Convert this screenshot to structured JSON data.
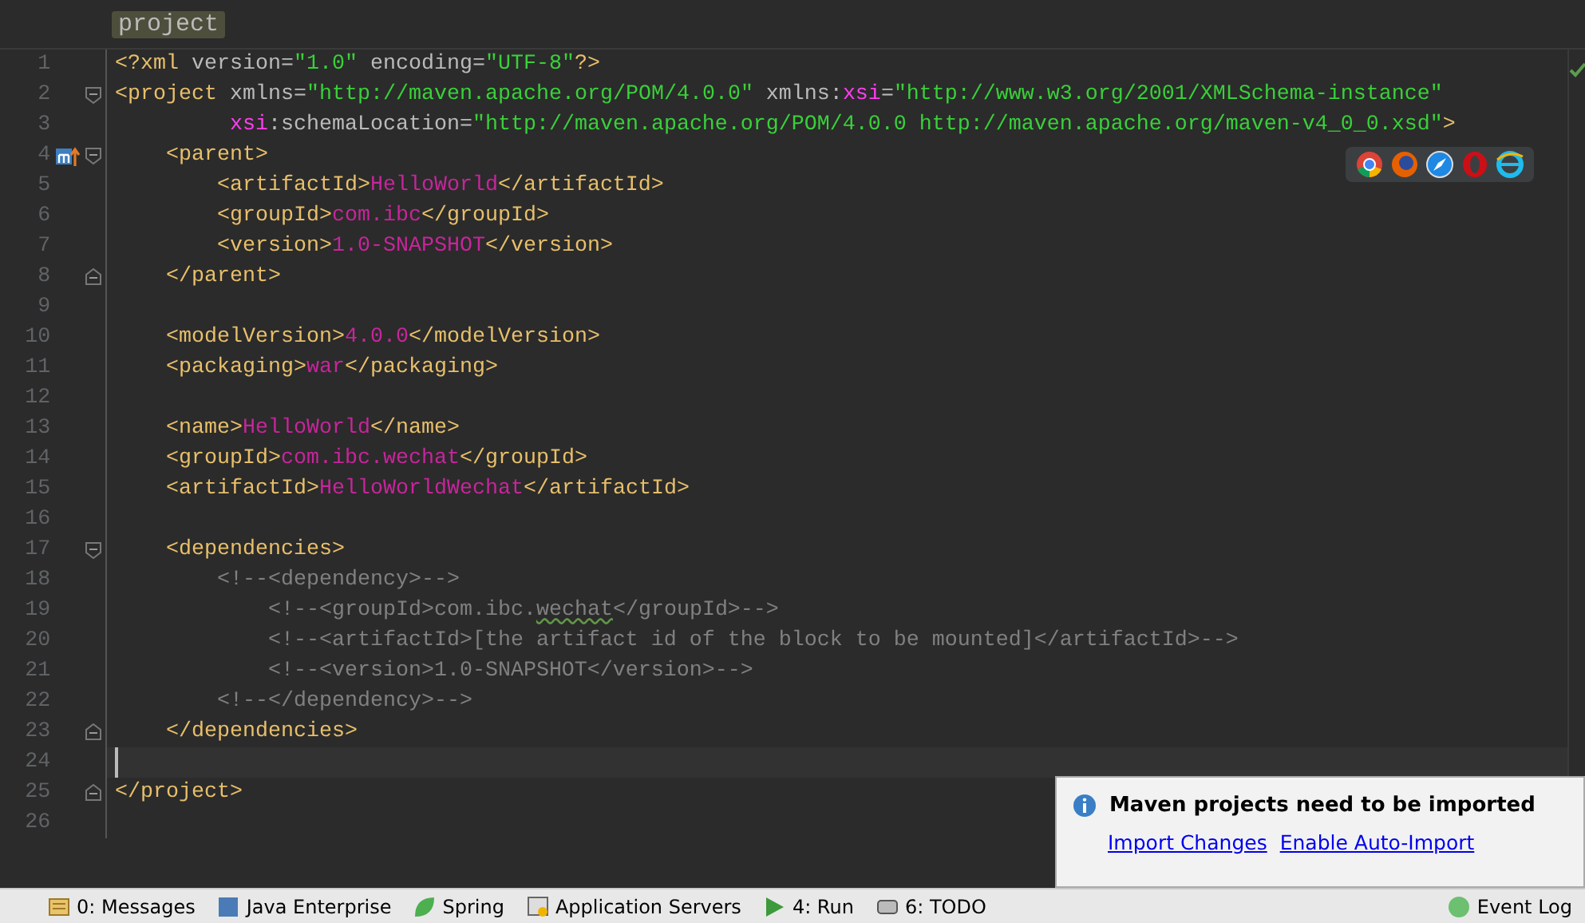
{
  "breadcrumb": {
    "label": "project"
  },
  "lines": [
    {
      "number": "1",
      "fold_start": false,
      "fold_end": false,
      "override": false,
      "current": false,
      "tokens": [
        {
          "kind": "tag",
          "text": "<?xml"
        },
        {
          "kind": "attr",
          "text": " version="
        },
        {
          "kind": "value",
          "text": "\"1.0\""
        },
        {
          "kind": "attr",
          "text": " encoding="
        },
        {
          "kind": "value",
          "text": "\"UTF-8\""
        },
        {
          "kind": "tag",
          "text": "?>"
        }
      ]
    },
    {
      "number": "2",
      "fold_start": true,
      "fold_end": false,
      "override": false,
      "current": false,
      "tokens": [
        {
          "kind": "tag",
          "text": "<project"
        },
        {
          "kind": "attr",
          "text": " xmlns="
        },
        {
          "kind": "value",
          "text": "\"http://maven.apache.org/POM/4.0.0\""
        },
        {
          "kind": "attr",
          "text": " xmlns:"
        },
        {
          "kind": "ns",
          "text": "xsi"
        },
        {
          "kind": "attr",
          "text": "="
        },
        {
          "kind": "value",
          "text": "\"http://www.w3.org/2001/XMLSchema-instance\""
        }
      ]
    },
    {
      "number": "3",
      "fold_start": false,
      "fold_end": false,
      "override": false,
      "current": false,
      "tokens": [
        {
          "kind": "ns",
          "text": "         xsi"
        },
        {
          "kind": "attr",
          "text": ":schemaLocation="
        },
        {
          "kind": "value",
          "text": "\"http://maven.apache.org/POM/4.0.0 http://maven.apache.org/maven-v4_0_0.xsd\""
        },
        {
          "kind": "tag",
          "text": ">"
        }
      ]
    },
    {
      "number": "4",
      "fold_start": true,
      "fold_end": false,
      "override": true,
      "current": false,
      "tokens": [
        {
          "kind": "tag",
          "text": "    <parent>"
        }
      ]
    },
    {
      "number": "5",
      "fold_start": false,
      "fold_end": false,
      "override": false,
      "current": false,
      "tokens": [
        {
          "kind": "tag",
          "text": "        <artifactId>"
        },
        {
          "kind": "content",
          "text": "HelloWorld"
        },
        {
          "kind": "tag",
          "text": "</artifactId>"
        }
      ]
    },
    {
      "number": "6",
      "fold_start": false,
      "fold_end": false,
      "override": false,
      "current": false,
      "tokens": [
        {
          "kind": "tag",
          "text": "        <groupId>"
        },
        {
          "kind": "content",
          "text": "com.ibc"
        },
        {
          "kind": "tag",
          "text": "</groupId>"
        }
      ]
    },
    {
      "number": "7",
      "fold_start": false,
      "fold_end": false,
      "override": false,
      "current": false,
      "tokens": [
        {
          "kind": "tag",
          "text": "        <version>"
        },
        {
          "kind": "content",
          "text": "1.0-SNAPSHOT"
        },
        {
          "kind": "tag",
          "text": "</version>"
        }
      ]
    },
    {
      "number": "8",
      "fold_start": false,
      "fold_end": true,
      "override": false,
      "current": false,
      "tokens": [
        {
          "kind": "tag",
          "text": "    </parent>"
        }
      ]
    },
    {
      "number": "9",
      "fold_start": false,
      "fold_end": false,
      "override": false,
      "current": false
    },
    {
      "number": "10",
      "fold_start": false,
      "fold_end": false,
      "override": false,
      "current": false,
      "tokens": [
        {
          "kind": "tag",
          "text": "    <modelVersion>"
        },
        {
          "kind": "content",
          "text": "4.0.0"
        },
        {
          "kind": "tag",
          "text": "</modelVersion>"
        }
      ]
    },
    {
      "number": "11",
      "fold_start": false,
      "fold_end": false,
      "override": false,
      "current": false,
      "tokens": [
        {
          "kind": "tag",
          "text": "    <packaging>"
        },
        {
          "kind": "content",
          "text": "war"
        },
        {
          "kind": "tag",
          "text": "</packaging>"
        }
      ]
    },
    {
      "number": "12",
      "fold_start": false,
      "fold_end": false,
      "override": false,
      "current": false
    },
    {
      "number": "13",
      "fold_start": false,
      "fold_end": false,
      "override": false,
      "current": false,
      "tokens": [
        {
          "kind": "tag",
          "text": "    <name>"
        },
        {
          "kind": "content",
          "text": "HelloWorld"
        },
        {
          "kind": "tag",
          "text": "</name>"
        }
      ]
    },
    {
      "number": "14",
      "fold_start": false,
      "fold_end": false,
      "override": false,
      "current": false,
      "tokens": [
        {
          "kind": "tag",
          "text": "    <groupId>"
        },
        {
          "kind": "content",
          "text": "com.ibc.wechat"
        },
        {
          "kind": "tag",
          "text": "</groupId>"
        }
      ]
    },
    {
      "number": "15",
      "fold_start": false,
      "fold_end": false,
      "override": false,
      "current": false,
      "tokens": [
        {
          "kind": "tag",
          "text": "    <artifactId>"
        },
        {
          "kind": "content",
          "text": "HelloWorldWechat"
        },
        {
          "kind": "tag",
          "text": "</artifactId>"
        }
      ]
    },
    {
      "number": "16",
      "fold_start": false,
      "fold_end": false,
      "override": false,
      "current": false
    },
    {
      "number": "17",
      "fold_start": true,
      "fold_end": false,
      "override": false,
      "current": false,
      "tokens": [
        {
          "kind": "tag",
          "text": "    <dependencies>"
        }
      ]
    },
    {
      "number": "18",
      "fold_start": false,
      "fold_end": false,
      "override": false,
      "current": false,
      "tokens": [
        {
          "kind": "comment",
          "text": "        <!--<dependency>-->"
        }
      ]
    },
    {
      "number": "19",
      "fold_start": false,
      "fold_end": false,
      "override": false,
      "current": false,
      "tokens": [
        {
          "kind": "comment",
          "text": "            <!--<groupId>com.ibc."
        },
        {
          "kind": "typo",
          "text": "wechat"
        },
        {
          "kind": "comment",
          "text": "</groupId>-->"
        }
      ]
    },
    {
      "number": "20",
      "fold_start": false,
      "fold_end": false,
      "override": false,
      "current": false,
      "tokens": [
        {
          "kind": "comment",
          "text": "            <!--<artifactId>[the artifact id of the block to be mounted]</artifactId>-->"
        }
      ]
    },
    {
      "number": "21",
      "fold_start": false,
      "fold_end": false,
      "override": false,
      "current": false,
      "tokens": [
        {
          "kind": "comment",
          "text": "            <!--<version>1.0-SNAPSHOT</version>-->"
        }
      ]
    },
    {
      "number": "22",
      "fold_start": false,
      "fold_end": false,
      "override": false,
      "current": false,
      "tokens": [
        {
          "kind": "comment",
          "text": "        <!--</dependency>-->"
        }
      ]
    },
    {
      "number": "23",
      "fold_start": false,
      "fold_end": true,
      "override": false,
      "current": false,
      "tokens": [
        {
          "kind": "tag",
          "text": "    </dependencies>"
        }
      ]
    },
    {
      "number": "24",
      "fold_start": false,
      "fold_end": false,
      "override": false,
      "current": true
    },
    {
      "number": "25",
      "fold_start": false,
      "fold_end": true,
      "override": false,
      "current": false,
      "tokens": [
        {
          "kind": "tag",
          "text": "</project>"
        }
      ]
    },
    {
      "number": "26",
      "fold_start": false,
      "fold_end": false,
      "override": false,
      "current": false
    }
  ],
  "browsers": [
    {
      "kind": "chrome"
    },
    {
      "kind": "firefox"
    },
    {
      "kind": "safari"
    },
    {
      "kind": "opera"
    },
    {
      "kind": "ie"
    }
  ],
  "notification": {
    "title": "Maven projects need to be imported",
    "links": [
      "Import Changes",
      "Enable Auto-Import"
    ]
  },
  "tool_windows": [
    {
      "label": "0: Messages",
      "kind": "messages"
    },
    {
      "label": "Java Enterprise",
      "kind": "javaee"
    },
    {
      "label": "Spring",
      "kind": "spring"
    },
    {
      "label": "Application Servers",
      "kind": "servers"
    },
    {
      "label": "4: Run",
      "kind": "run"
    },
    {
      "label": "6: TODO",
      "kind": "todo"
    }
  ],
  "event_log": {
    "label": "Event Log"
  }
}
